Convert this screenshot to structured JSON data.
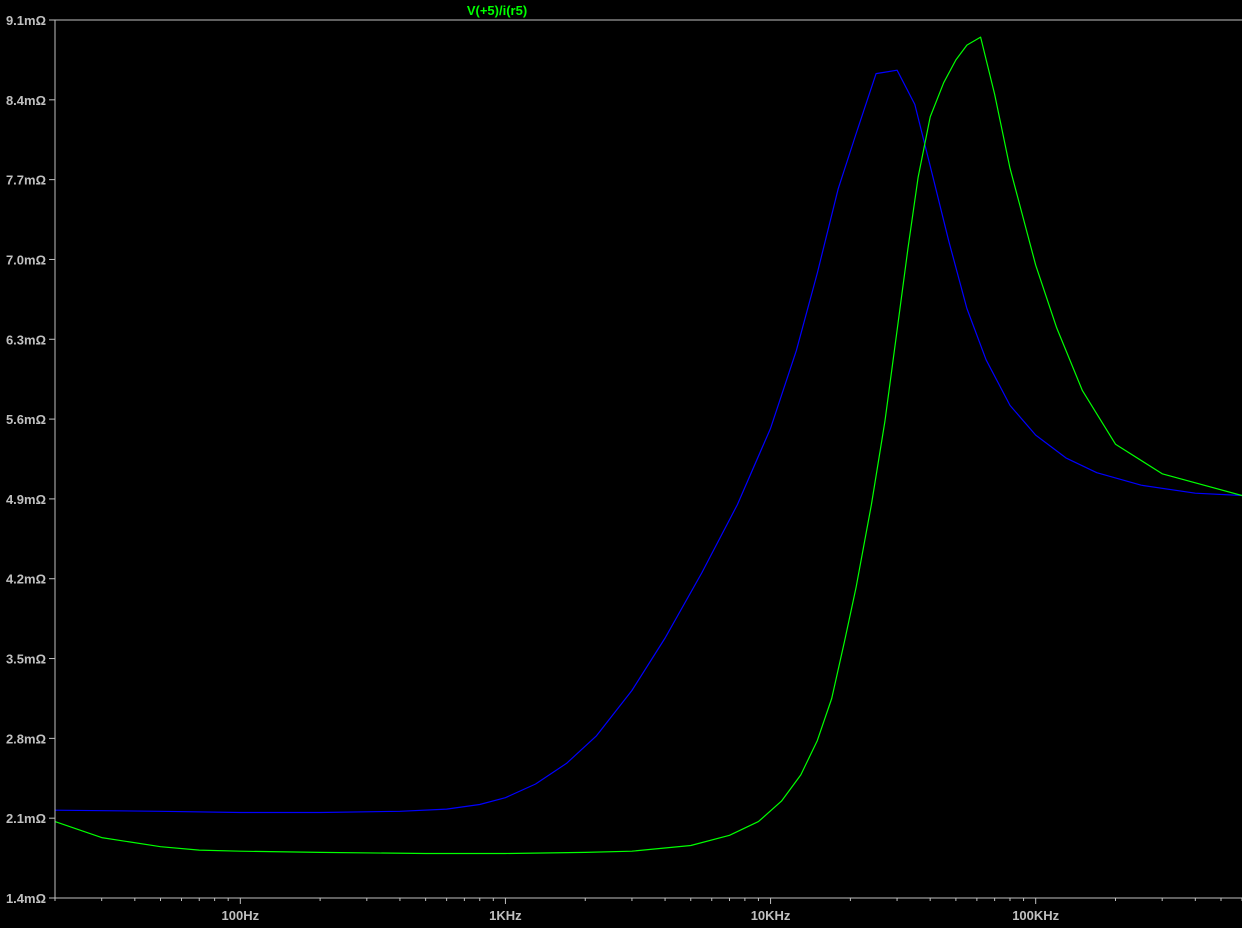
{
  "chart_data": {
    "type": "line",
    "title": "V(+5)/i(r5)",
    "x_scale": "log",
    "xlim": [
      20,
      600000
    ],
    "ylim": [
      1.4,
      9.1
    ],
    "x_ticks": [
      {
        "value": 100,
        "label": "100Hz"
      },
      {
        "value": 1000,
        "label": "1KHz"
      },
      {
        "value": 10000,
        "label": "10KHz"
      },
      {
        "value": 100000,
        "label": "100KHz"
      }
    ],
    "y_ticks": [
      {
        "value": 9.1,
        "label": "9.1mΩ"
      },
      {
        "value": 8.4,
        "label": "8.4mΩ"
      },
      {
        "value": 7.7,
        "label": "7.7mΩ"
      },
      {
        "value": 7.0,
        "label": "7.0mΩ"
      },
      {
        "value": 6.3,
        "label": "6.3mΩ"
      },
      {
        "value": 5.6,
        "label": "5.6mΩ"
      },
      {
        "value": 4.9,
        "label": "4.9mΩ"
      },
      {
        "value": 4.2,
        "label": "4.2mΩ"
      },
      {
        "value": 3.5,
        "label": "3.5mΩ"
      },
      {
        "value": 2.8,
        "label": "2.8mΩ"
      },
      {
        "value": 2.1,
        "label": "2.1mΩ"
      },
      {
        "value": 1.4,
        "label": "1.4mΩ"
      }
    ],
    "grid": false,
    "colors": {
      "background": "#000000",
      "axis": "#c0c0c0",
      "title": "#00ff00"
    },
    "series": [
      {
        "color": "#0000ff",
        "x": [
          20,
          50,
          100,
          200,
          400,
          600,
          800,
          1000,
          1300,
          1700,
          2200,
          3000,
          4000,
          5500,
          7500,
          10000,
          12500,
          15000,
          18000,
          21000,
          25000,
          30000,
          35000,
          40000,
          47000,
          55000,
          65000,
          80000,
          100000,
          130000,
          170000,
          250000,
          400000,
          600000
        ],
        "values": [
          2.17,
          2.16,
          2.15,
          2.15,
          2.16,
          2.18,
          2.22,
          2.28,
          2.4,
          2.58,
          2.82,
          3.22,
          3.68,
          4.25,
          4.85,
          5.52,
          6.2,
          6.88,
          7.62,
          8.1,
          8.63,
          8.66,
          8.36,
          7.82,
          7.16,
          6.57,
          6.12,
          5.72,
          5.46,
          5.26,
          5.13,
          5.02,
          4.95,
          4.93
        ]
      },
      {
        "color": "#00ff00",
        "x": [
          20,
          30,
          50,
          70,
          100,
          200,
          500,
          1000,
          2000,
          3000,
          5000,
          7000,
          9000,
          11000,
          13000,
          15000,
          17000,
          19000,
          21000,
          24000,
          27000,
          30000,
          33000,
          36000,
          40000,
          45000,
          50000,
          55000,
          62000,
          70000,
          80000,
          90000,
          100000,
          120000,
          150000,
          200000,
          300000,
          600000
        ],
        "values": [
          2.07,
          1.93,
          1.85,
          1.82,
          1.81,
          1.8,
          1.79,
          1.79,
          1.8,
          1.81,
          1.86,
          1.95,
          2.07,
          2.25,
          2.48,
          2.78,
          3.15,
          3.65,
          4.12,
          4.85,
          5.58,
          6.38,
          7.1,
          7.72,
          8.25,
          8.55,
          8.75,
          8.88,
          8.95,
          8.45,
          7.8,
          7.35,
          6.95,
          6.4,
          5.85,
          5.38,
          5.12,
          4.93
        ]
      }
    ]
  }
}
